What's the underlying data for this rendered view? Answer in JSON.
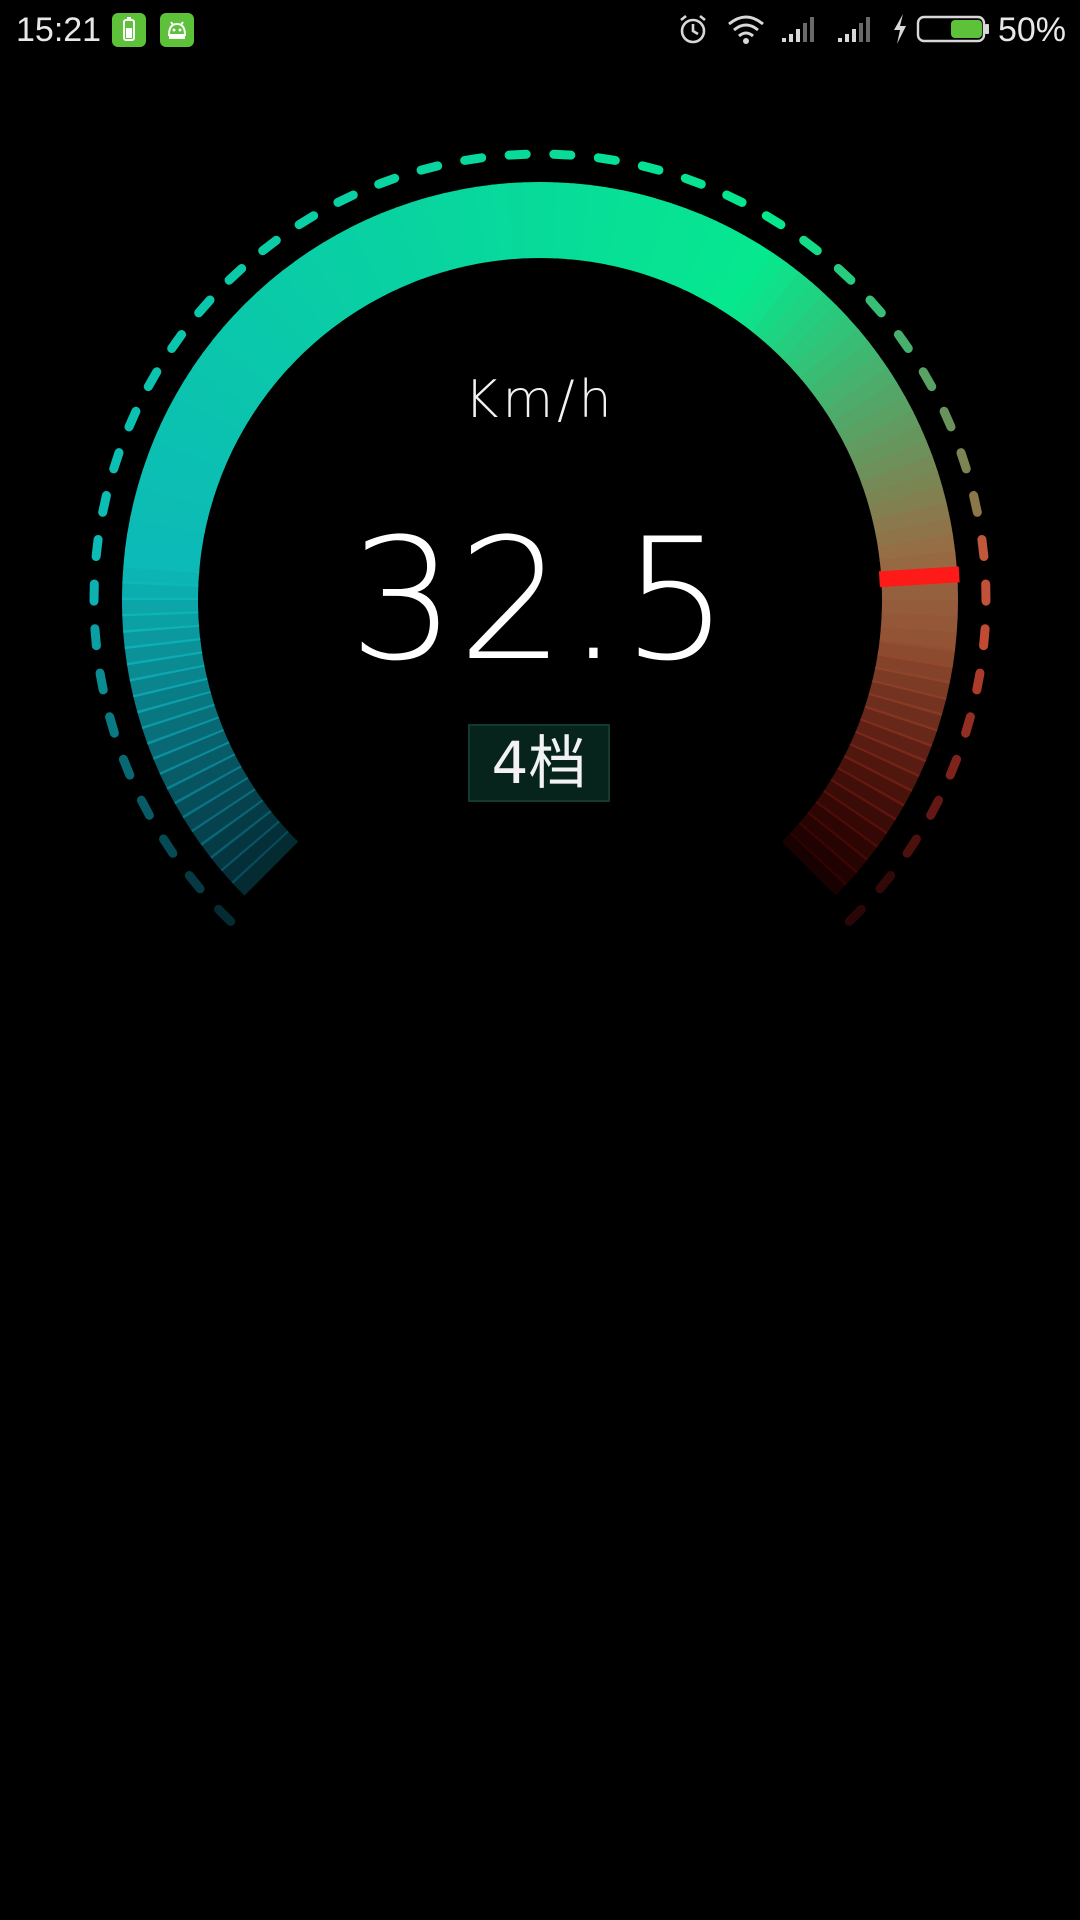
{
  "status_bar": {
    "time": "15:21",
    "battery_percent": "50%",
    "battery_level": 0.5,
    "notification_icons": [
      "battery-app-icon",
      "android-app-icon"
    ],
    "system_icons": [
      "alarm-icon",
      "wifi-icon",
      "signal-icon",
      "signal-icon",
      "charging-icon",
      "battery-icon"
    ],
    "colors": {
      "app_icon": "#5ec13a",
      "battery_fill": "#5ec13a"
    }
  },
  "speedometer": {
    "unit": "Km/h",
    "speed": "32.5",
    "gear": "4档",
    "colors": {
      "arc_start": "#0fa6c9",
      "arc_mid": "#06e88e",
      "arc_end": "#8b0000",
      "marker": "#ff1a1a"
    }
  }
}
